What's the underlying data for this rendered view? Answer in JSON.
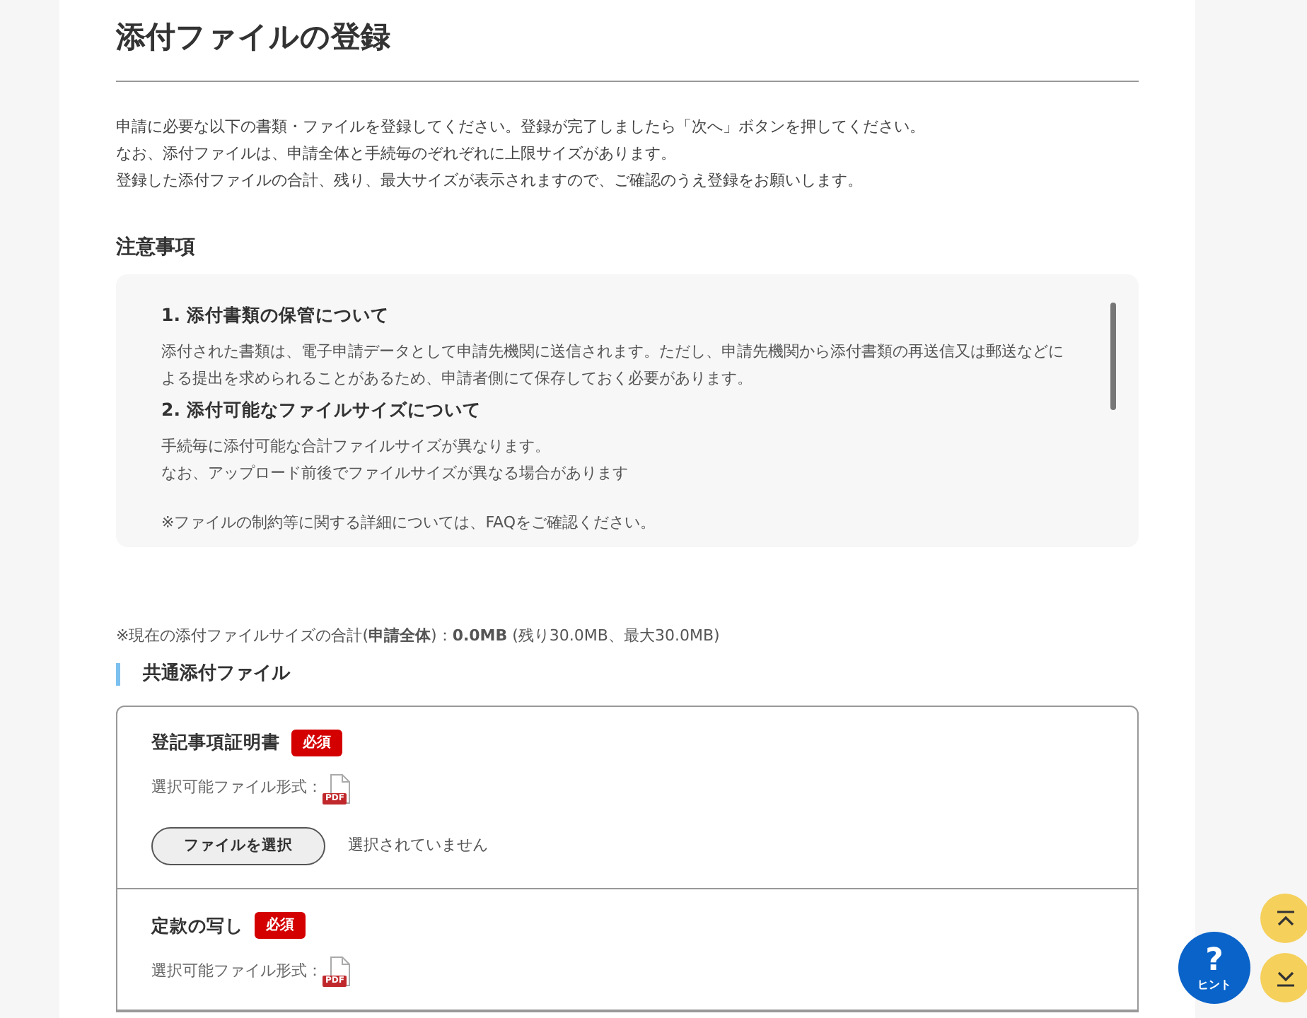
{
  "page_title": "添付ファイルの登録",
  "intro_lines": [
    "申請に必要な以下の書類・ファイルを登録してください。登録が完了しましたら「次へ」ボタンを押してください。",
    "なお、添付ファイルは、申請全体と手続毎のぞれぞれに上限サイズがあります。",
    "登録した添付ファイルの合計、残り、最大サイズが表示されますので、ご確認のうえ登録をお願いします。"
  ],
  "notice": {
    "heading": "注意事項",
    "sections": [
      {
        "title": "1. 添付書類の保管について",
        "lines": [
          "添付された書類は、電子申請データとして申請先機関に送信されます。ただし、申請先機関から添付書類の再送信又は郵送などによる提出を求められることがあるため、申請者側にて保存しておく必要があります。"
        ]
      },
      {
        "title": "2. 添付可能なファイルサイズについて",
        "lines": [
          "手続毎に添付可能な合計ファイルサイズが異なります。",
          "なお、アップロード前後でファイルサイズが異なる場合があります"
        ]
      }
    ],
    "footnote": "※ファイルの制約等に関する詳細については、FAQをご確認ください。"
  },
  "size_summary": "※現在の添付ファイルサイズの合計(**申請全体**)：**0.0MB** (残り30.0MB、最大30.0MB)",
  "section": {
    "title": "共通添付ファイル",
    "items": [
      {
        "name": "登記事項証明書",
        "required": true,
        "required_label": "必須",
        "formats_label": "選択可能ファイル形式：",
        "formats": [
          "PDF"
        ],
        "button": "ファイルを選択",
        "status": "選択されていません"
      },
      {
        "name": "定款の写し",
        "required": true,
        "required_label": "必須",
        "formats_label": "選択可能ファイル形式：",
        "formats": [
          "PDF"
        ]
      }
    ]
  },
  "hint": {
    "symbol": "?",
    "label": "ヒント"
  }
}
